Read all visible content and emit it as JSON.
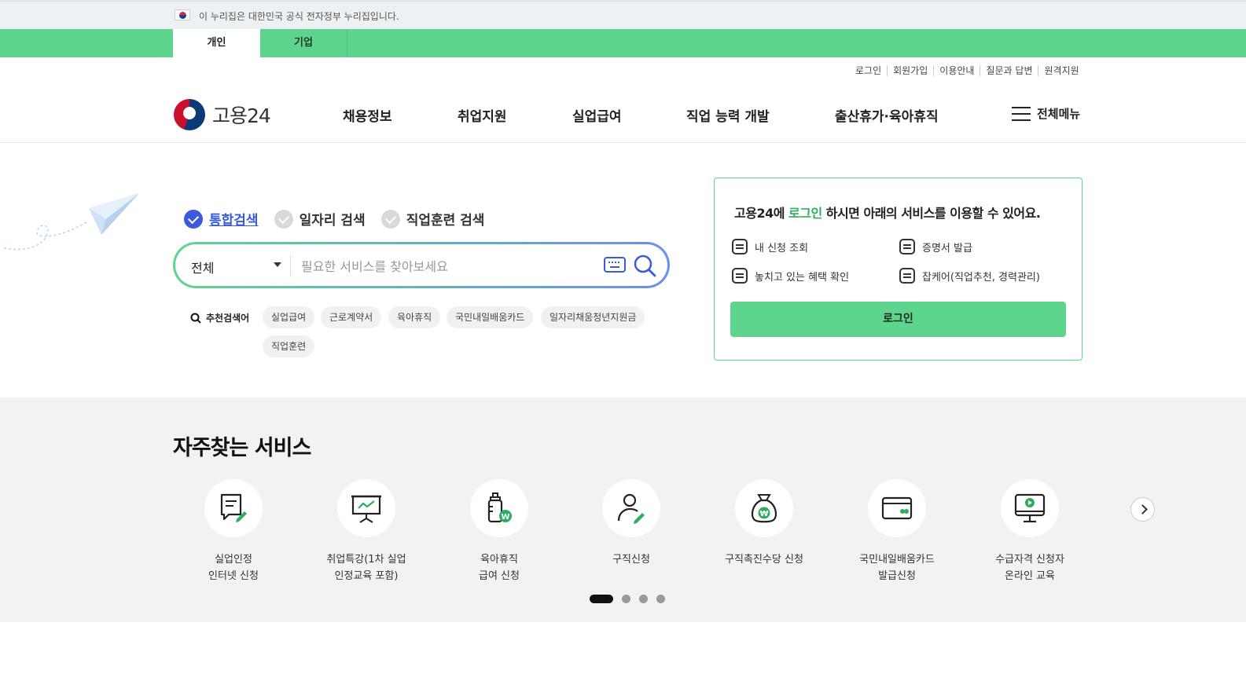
{
  "gov_banner": {
    "text": "이 누리집은 대한민국 공식 전자정부 누리집입니다."
  },
  "user_tabs": [
    {
      "label": "개인"
    },
    {
      "label": "기업"
    }
  ],
  "util_links": [
    "로그인",
    "회원가입",
    "이용안내",
    "질문과 답변",
    "원격지원"
  ],
  "logo": {
    "text": "고용24"
  },
  "nav": [
    "채용정보",
    "취업지원",
    "실업급여",
    "직업 능력 개발",
    "출산휴가·육아휴직"
  ],
  "menu_all": {
    "label": "전체메뉴"
  },
  "search": {
    "tabs": [
      "통합검색",
      "일자리 검색",
      "직업훈련 검색"
    ],
    "active_tab": "통합검색",
    "select_value": "전체",
    "placeholder": "필요한 서비스를 찾아보세요"
  },
  "recommended": {
    "label": "추천검색어",
    "keywords": [
      "실업급여",
      "근로계약서",
      "육아휴직",
      "국민내일배움카드",
      "일자리채움청년지원금",
      "직업훈련"
    ]
  },
  "login_card": {
    "msg_prefix": "고용24에 ",
    "msg_highlight": "로그인",
    "msg_suffix": " 하시면 아래의 서비스를 이용할 수 있어요.",
    "services": [
      "내 신청 조회",
      "증명서 발급",
      "놓치고 있는 혜택 확인",
      "잡케어(직업추천, 경력관리)"
    ],
    "button": "로그인"
  },
  "frequent": {
    "title": "자주찾는 서비스",
    "items": [
      {
        "line1": "실업인정",
        "line2": "인터넷 신청"
      },
      {
        "line1": "취업특강(1차 실업",
        "line2": "인정교육 포함)"
      },
      {
        "line1": "육아휴직",
        "line2": "급여 신청"
      },
      {
        "line1": "구직신청",
        "line2": ""
      },
      {
        "line1": "구직촉진수당 신청",
        "line2": ""
      },
      {
        "line1": "국민내일배움카드",
        "line2": "발급신청"
      },
      {
        "line1": "수급자격 신청자",
        "line2": "온라인 교육"
      }
    ],
    "pagination": {
      "current": 1,
      "total": 4
    }
  },
  "colors": {
    "brand_green": "#5ed58f",
    "accent_blue": "#3b5bdb",
    "highlight_green": "#2eac5f"
  }
}
